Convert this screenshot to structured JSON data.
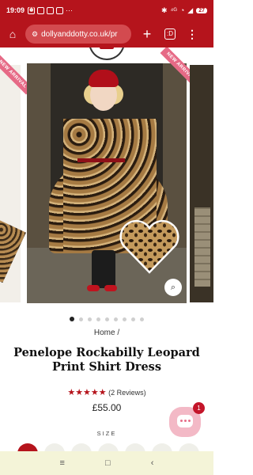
{
  "statusbar": {
    "time": "19:09",
    "icons": [
      "alarm-icon",
      "gallery-icon",
      "mail-icon",
      "messenger-icon",
      "more-icon"
    ],
    "right_icons": [
      "bluetooth-icon",
      "network-icon",
      "wifi-icon",
      "signal-icon"
    ],
    "battery": "27",
    "more": "···"
  },
  "browser": {
    "url": "dollyanddotty.co.uk/pr",
    "tab_count": ":D",
    "plus": "+",
    "menu": "⋮"
  },
  "gallery": {
    "badge_text": "NEW ARRIVAL",
    "dots_total": 9,
    "active_dot": 0,
    "zoom_icon": "zoom-icon"
  },
  "product": {
    "breadcrumb": "Home /",
    "title": "Penelope Rockabilly Leopard Print Shirt Dress",
    "stars": "★★★★★",
    "rating": 5,
    "reviews": "(2 Reviews)",
    "price": "£55.00",
    "size_label": "SIZE"
  },
  "chat": {
    "notification_count": "1"
  },
  "navbar": {
    "recent": "≡",
    "home": "□",
    "back": "‹"
  },
  "colors": {
    "brand_red": "#b5141c",
    "badge_pink": "#e66a86",
    "chat_pink": "#f3b9c6"
  }
}
